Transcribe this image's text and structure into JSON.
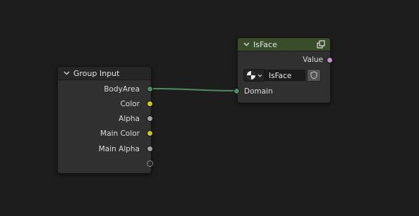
{
  "colors": {
    "background": "#1d1d1d",
    "node_body": "#303030",
    "isface_header": "#394d2a",
    "socket_geometry": "#4f8b62",
    "socket_color": "#c7c729",
    "socket_float": "#a1a1a1",
    "socket_string": "#c192c7",
    "link": "#4f8b62"
  },
  "group_input": {
    "title": "Group Input",
    "outputs": [
      {
        "label": "BodyArea",
        "icon": "geometry-socket",
        "color": "#4f8b62"
      },
      {
        "label": "Color",
        "icon": "color-socket",
        "color": "#c7c729"
      },
      {
        "label": "Alpha",
        "icon": "float-socket",
        "color": "#a1a1a1"
      },
      {
        "label": "Main Color",
        "icon": "color-socket",
        "color": "#c7c729"
      },
      {
        "label": "Main Alpha",
        "icon": "float-socket",
        "color": "#a1a1a1"
      }
    ],
    "empty_socket": "virtual-socket"
  },
  "isface": {
    "title": "IsFace",
    "header_icon": "node-group-icon",
    "output_label": "Value",
    "field_icon": "attribute-type-icon",
    "field_value": "IsFace",
    "field_button_icon": "shield-icon",
    "input_label": "Domain"
  }
}
